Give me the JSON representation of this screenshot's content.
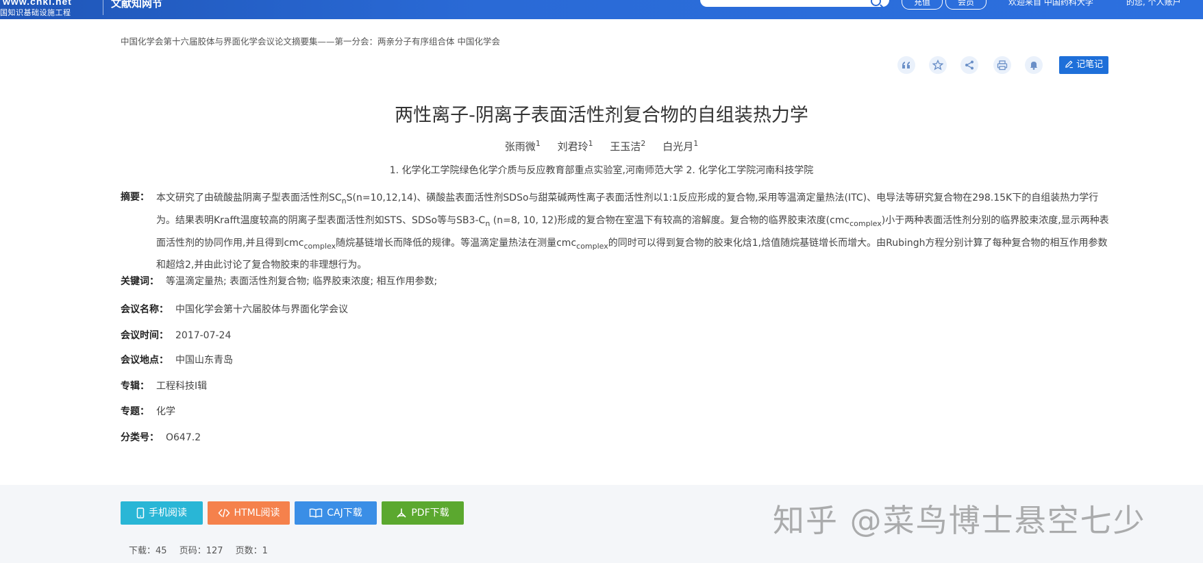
{
  "header": {
    "logo_url": "www.cnki.net",
    "logo_sub": "国知识基础设施工程",
    "site_name": "文献知网节",
    "search_placeholder": "",
    "btn_1": "充值",
    "btn_2": "会员",
    "welcome": "欢迎来自 中国药科大学",
    "user": "的您, 个人账户"
  },
  "breadcrumb": "中国化学会第十六届胶体与界面化学会议论文摘要集——第一分会：两亲分子有序组合体 中国化学会",
  "toolbar": {
    "icons": [
      "quote-icon",
      "star-icon",
      "share-icon",
      "print-icon",
      "bell-icon"
    ],
    "note_label": "记笔记"
  },
  "article": {
    "title": "两性离子-阴离子表面活性剂复合物的自组装热力学",
    "authors": [
      {
        "name": "张雨微",
        "sup": "1"
      },
      {
        "name": "刘君玲",
        "sup": "1"
      },
      {
        "name": "王玉洁",
        "sup": "2"
      },
      {
        "name": "白光月",
        "sup": "1"
      }
    ],
    "affiliations": "1. 化学化工学院绿色化学介质与反应教育部重点实验室,河南师范大学   2. 化学化工学院河南科技学院",
    "abstract_label": "摘要：",
    "abstract_parts": {
      "p1": "本文研究了由硫酸盐阴离子型表面活性剂SC",
      "p1_sub": "n",
      "p2": "S(n=10,12,14)、磺酸盐表面活性剂SDSo与甜菜碱两性离子表面活性剂以1:1反应形成的复合物,采用等温滴定量热法(ITC)、电导法等研究复合物在298.15K下的自组装热力学行为。结果表明Krafft温度较高的阴离子型表面活性剂如STS、SDSo等与SB3-C",
      "p2_sub": "n",
      "p3": " (n=8, 10, 12)形成的复合物在室温下有较高的溶解度。复合物的临界胶束浓度(cmc",
      "p3_sub": "complex",
      "p4": ")小于两种表面活性剂分别的临界胶束浓度,显示两种表面活性剂的协同作用,并且得到cmc",
      "p4_sub": "complex",
      "p5": "随烷基链增长而降低的规律。等温滴定量热法在测量cmc",
      "p5_sub": "complex",
      "p6": "的同时可以得到复合物的胶束化焓1,焓值随烷基链增长而增大。由Rubingh方程分别计算了每种复合物的相互作用参数和超焓2,并由此讨论了复合物胶束的非理想行为。"
    },
    "keywords_label": "关键词：",
    "keywords": "等温滴定量热;  表面活性剂复合物;  临界胶束浓度;  相互作用参数;",
    "meeting_name_label": "会议名称：",
    "meeting_name": "中国化学会第十六届胶体与界面化学会议",
    "meeting_time_label": "会议时间：",
    "meeting_time": "2017-07-24",
    "meeting_place_label": "会议地点：",
    "meeting_place": "中国山东青岛",
    "series_label": "专辑：",
    "series": "工程科技Ⅰ辑",
    "topic_label": "专题：",
    "topic": "化学",
    "classification_label": "分类号：",
    "classification": "O647.2"
  },
  "downloads": {
    "mobile": "手机阅读",
    "html": "HTML阅读",
    "caj": "CAJ下载",
    "pdf": "PDF下载"
  },
  "stats": {
    "downloads": "下载：45",
    "page_code": "页码：127",
    "page_count": "页数：1"
  },
  "watermark": "知乎 @菜鸟博士悬空七少",
  "colors": {
    "header_blue": "#2a6ad6",
    "mobile_btn": "#29b6d6",
    "html_btn": "#f5814c",
    "caj_btn": "#3a8ee6",
    "pdf_btn": "#5ba82f",
    "note_btn": "#1e6fd9"
  }
}
